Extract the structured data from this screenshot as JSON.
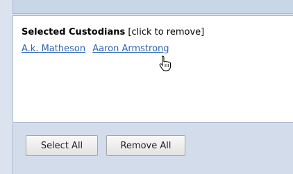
{
  "selected_custodians": {
    "heading": "Selected Custodians",
    "hint": "[click to remove]",
    "items": [
      "A.k. Matheson",
      "Aaron Armstrong"
    ]
  },
  "buttons": {
    "select_all": "Select All",
    "remove_all": "Remove All"
  },
  "cursor": {
    "icon": "hand-pointer-icon"
  },
  "colors": {
    "link": "#2a64b6",
    "panel_border": "#a9b9cf",
    "footer_bg": "#d3dcea"
  }
}
